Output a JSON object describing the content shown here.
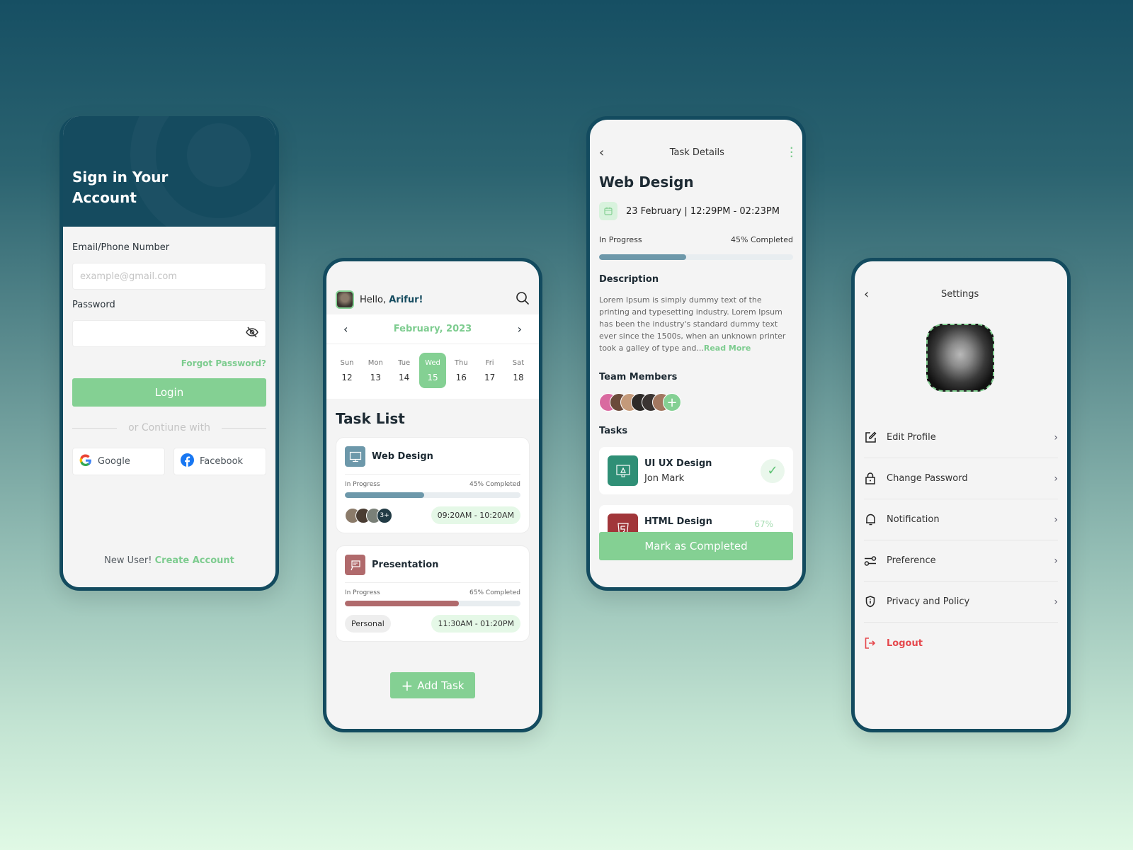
{
  "colors": {
    "primary": "#154b5f",
    "accent": "#84d093",
    "danger": "#e5484d",
    "web_design": "#6d98aa",
    "presentation": "#b06a6c",
    "uiux": "#2f8f76",
    "html": "#a1363a"
  },
  "signin": {
    "title": "Sign in Your Account",
    "email_label": "Email/Phone Number",
    "email_placeholder": "example@gmail.com",
    "password_label": "Password",
    "password_value": "",
    "visibility_icon": "eye-off-icon",
    "forgot": "Forgot Password?",
    "login": "Login",
    "divider": "or Contiune with",
    "google": "Google",
    "facebook": "Facebook",
    "new_user": "New User!",
    "create_account": "Create Account"
  },
  "tasklist": {
    "hello": "Hello,",
    "user": "Arifur!",
    "month": "February, 2023",
    "days": [
      {
        "name": "Sun",
        "num": "12"
      },
      {
        "name": "Mon",
        "num": "13"
      },
      {
        "name": "Tue",
        "num": "14"
      },
      {
        "name": "Wed",
        "num": "15",
        "active": true
      },
      {
        "name": "Thu",
        "num": "16"
      },
      {
        "name": "Fri",
        "num": "17"
      },
      {
        "name": "Sat",
        "num": "18"
      }
    ],
    "title": "Task List",
    "tasks": [
      {
        "name": "Web Design",
        "status": "In Progress",
        "completed": "45% Completed",
        "progress": 45,
        "members_extra": "3+",
        "time": "09:20AM - 10:20AM"
      },
      {
        "name": "Presentation",
        "status": "In Progress",
        "completed": "65% Completed",
        "progress": 65,
        "tag": "Personal",
        "time": "11:30AM - 01:20PM"
      }
    ],
    "add_task": "Add Task"
  },
  "details": {
    "header": "Task Details",
    "title": "Web Design",
    "date": "23 February | 12:29PM - 02:23PM",
    "status": "In Progress",
    "completed": "45% Completed",
    "progress": 45,
    "description_label": "Description",
    "description": "Lorem Ipsum is simply dummy text of the printing and typesetting industry. Lorem Ipsum has been the industry's standard dummy text ever since the 1500s, when an unknown printer took a galley of type and...",
    "read_more": "Read More",
    "team_label": "Team Members",
    "tasks_label": "Tasks",
    "subtasks": [
      {
        "name": "UI UX Design",
        "assignee": "Jon Mark",
        "done": true
      },
      {
        "name": "HTML Design",
        "percent": "67%"
      }
    ],
    "mark_completed": "Mark as Completed"
  },
  "settings": {
    "header": "Settings",
    "items": [
      {
        "label": "Edit Profile",
        "icon": "edit-icon"
      },
      {
        "label": "Change Password",
        "icon": "lock-icon"
      },
      {
        "label": "Notification",
        "icon": "bell-icon"
      },
      {
        "label": "Preference",
        "icon": "sliders-icon"
      },
      {
        "label": "Privacy and Policy",
        "icon": "shield-icon"
      }
    ],
    "logout": "Logout"
  }
}
